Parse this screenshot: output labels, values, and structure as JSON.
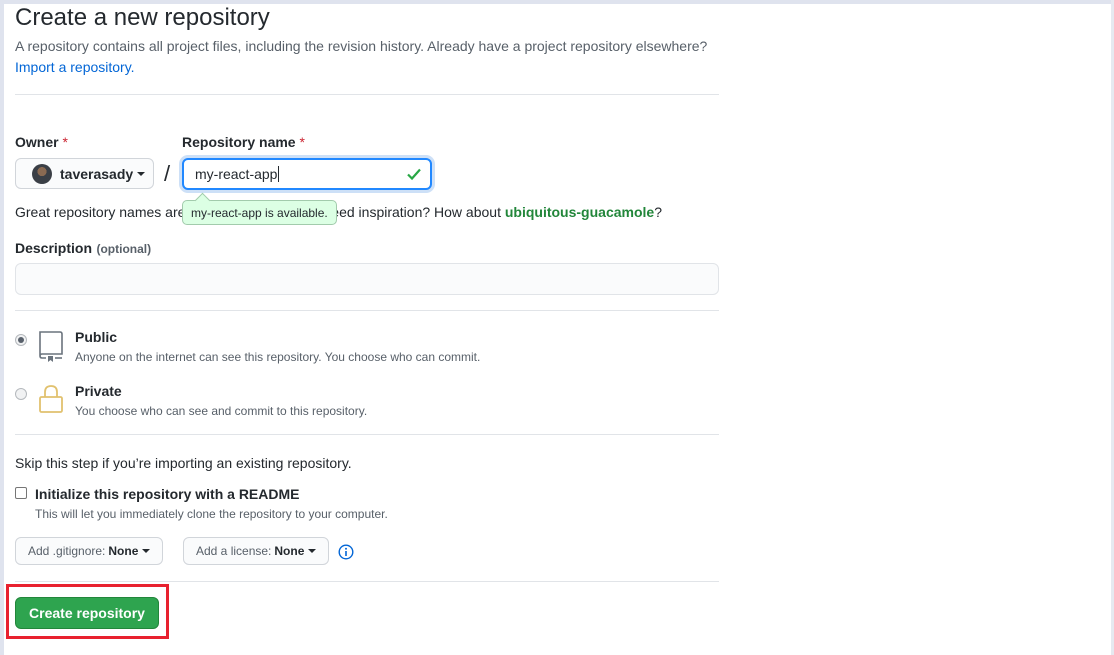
{
  "header": {
    "title": "Create a new repository",
    "subtitle": "A repository contains all project files, including the revision history. Already have a project repository elsewhere?",
    "import_link": "Import a repository."
  },
  "owner": {
    "label": "Owner",
    "required_mark": "*",
    "username": "taverasady"
  },
  "repo_name": {
    "label": "Repository name",
    "required_mark": "*",
    "value": "my-react-app",
    "separator": "/",
    "availability": "my-react-app is available.",
    "hint_prefix": "Great repository names are",
    "hint_middle": "eed inspiration? How about",
    "suggestion": "ubiquitous-guacamole",
    "hint_suffix": "?"
  },
  "description": {
    "label": "Description",
    "optional": "(optional)",
    "value": ""
  },
  "visibility": {
    "options": [
      {
        "title": "Public",
        "desc": "Anyone on the internet can see this repository. You choose who can commit.",
        "selected": true
      },
      {
        "title": "Private",
        "desc": "You choose who can see and commit to this repository.",
        "selected": false
      }
    ]
  },
  "init": {
    "skip_text": "Skip this step if you’re importing an existing repository.",
    "readme_label": "Initialize this repository with a README",
    "readme_desc": "This will let you immediately clone the repository to your computer.",
    "readme_checked": false,
    "gitignore_prefix": "Add .gitignore:",
    "gitignore_value": "None",
    "license_prefix": "Add a license:",
    "license_value": "None"
  },
  "actions": {
    "create_label": "Create repository"
  },
  "colors": {
    "accent_blue": "#0366d6",
    "create_green": "#2ea44f",
    "available_green": "#dcffe4",
    "highlight_red": "#e8212f"
  }
}
